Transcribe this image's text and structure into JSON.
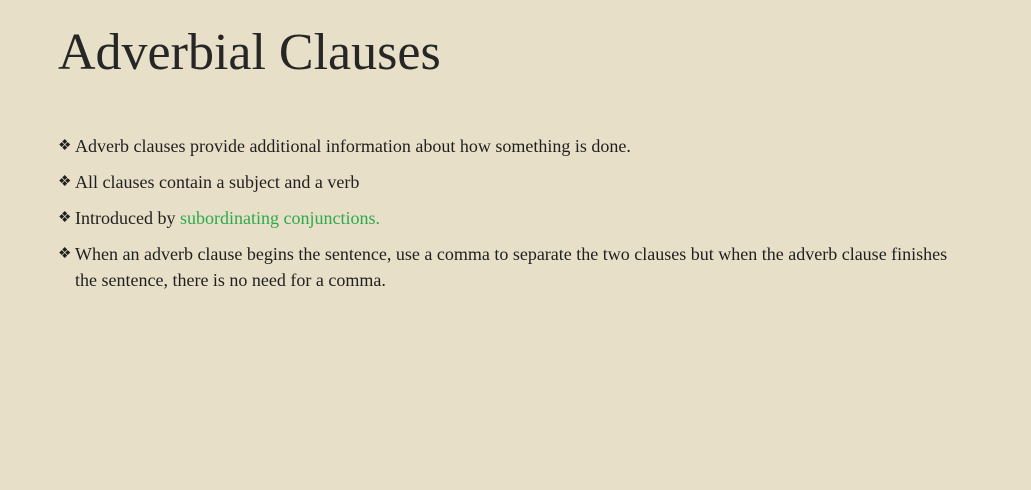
{
  "slide": {
    "title": "Adverbial Clauses",
    "bullet_icon": "diamond-four-icon",
    "bullet_glyph": "❖",
    "accent_color": "#2eaa4e",
    "bullets": [
      {
        "text": "Adverb clauses provide additional information about how something is done."
      },
      {
        "text": "All clauses contain a subject and a verb"
      },
      {
        "text_before": "Introduced by ",
        "highlight": "subordinating conjunctions."
      },
      {
        "text": "When an adverb clause begins the sentence, use a comma to separate the two clauses but when the adverb clause finishes the sentence, there is no need for a comma."
      }
    ]
  }
}
